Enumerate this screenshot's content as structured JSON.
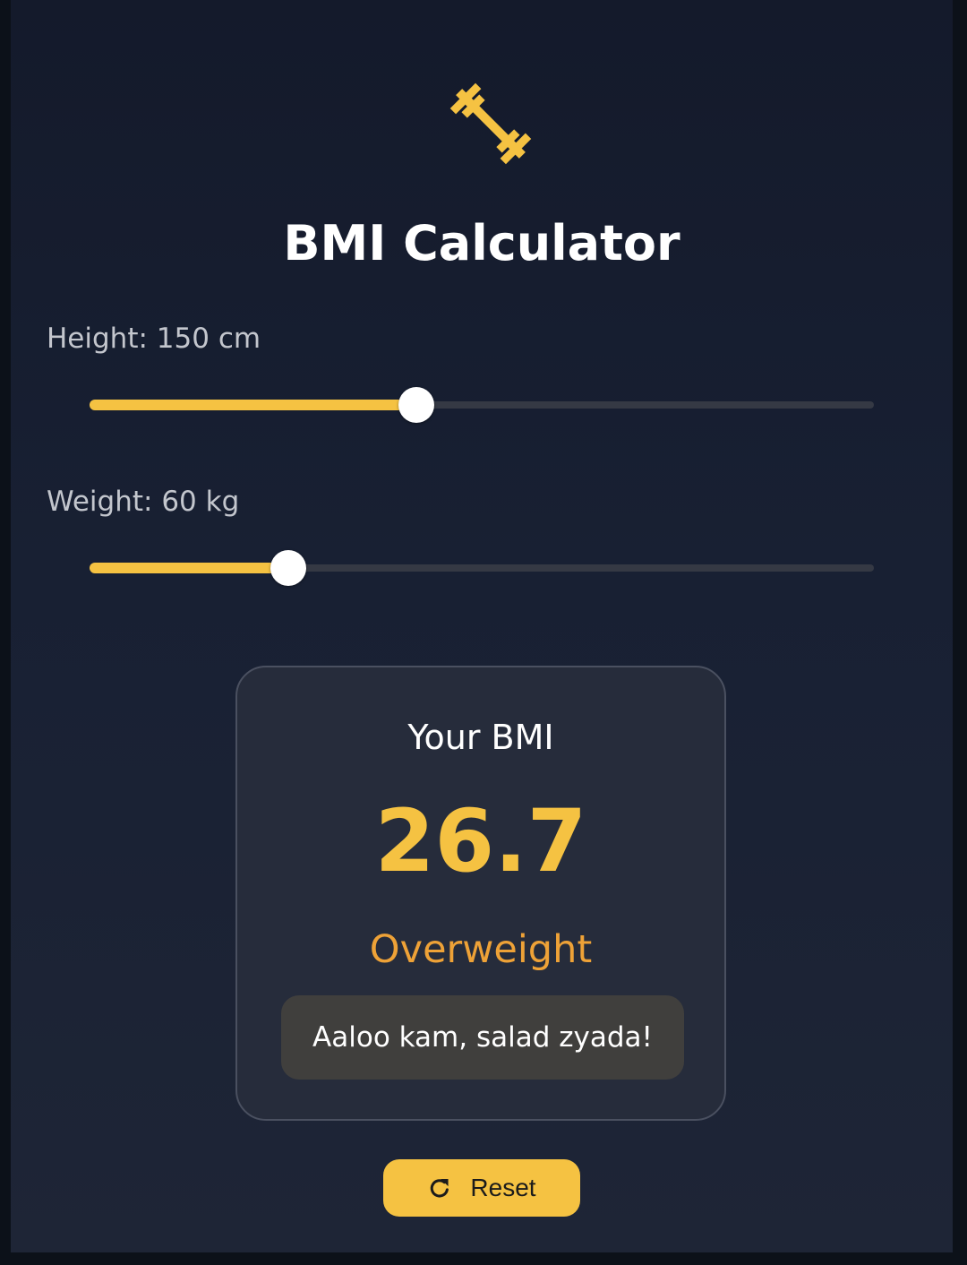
{
  "app": {
    "title": "BMI Calculator",
    "logo_icon": "dumbbell-icon",
    "accent_color": "#f5c242"
  },
  "height": {
    "label": "Height:",
    "value": "150",
    "unit": "cm",
    "slider_fraction": 0.417
  },
  "weight": {
    "label": "Weight:",
    "value": "60",
    "unit": "kg",
    "slider_fraction": 0.253
  },
  "result": {
    "label": "Your BMI",
    "value": "26.7",
    "category": "Overweight",
    "category_color": "#eea237",
    "advice": "Aaloo kam, salad zyada!"
  },
  "reset": {
    "icon": "refresh-icon",
    "label": "Reset"
  }
}
